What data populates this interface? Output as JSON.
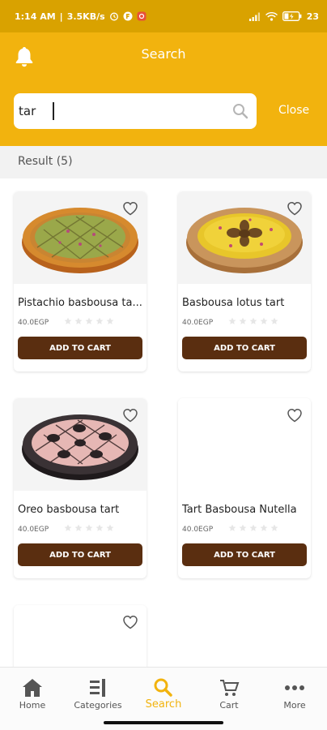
{
  "status_bar": {
    "time": "1:14 AM",
    "speed": "3.5KB/s",
    "battery": "23"
  },
  "header": {
    "title": "Search",
    "search_value": "tar",
    "close_label": "Close"
  },
  "results": {
    "label": "Result",
    "count": "(5)"
  },
  "add_to_cart_label": "ADD TO CART",
  "products": [
    {
      "name": "Pistachio basbousa ta...",
      "price": "40.0EGP"
    },
    {
      "name": "Basbousa lotus tart",
      "price": "40.0EGP"
    },
    {
      "name": "Oreo basbousa tart",
      "price": "40.0EGP"
    },
    {
      "name": "Tart Basbousa Nutella",
      "price": "40.0EGP"
    },
    {
      "name": "",
      "price": ""
    }
  ],
  "nav": [
    {
      "label": "Home",
      "icon": "home-icon"
    },
    {
      "label": "Categories",
      "icon": "categories-icon"
    },
    {
      "label": "Search",
      "icon": "search-icon"
    },
    {
      "label": "Cart",
      "icon": "cart-icon"
    },
    {
      "label": "More",
      "icon": "more-icon"
    }
  ],
  "colors": {
    "accent": "#f2b30e",
    "button": "#5a2e10"
  }
}
